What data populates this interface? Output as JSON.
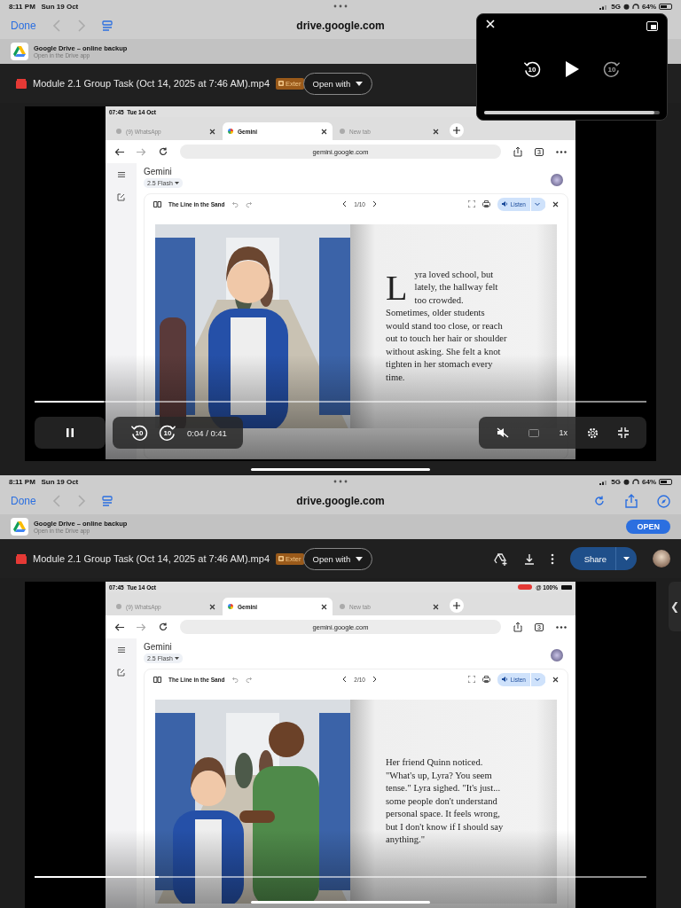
{
  "screens": [
    {
      "status": {
        "time": "8:11 PM",
        "date": "Sun 19 Oct",
        "network": "5G",
        "battery": "64%"
      },
      "toolbar": {
        "done": "Done",
        "url": "drive.google.com"
      },
      "banner": {
        "title": "Google Drive – online backup",
        "subtitle": "Open in the Drive app"
      },
      "file": {
        "name": "Module 2.1 Group Task (Oct 14, 2025 at 7:46 AM).mp4",
        "badge": "Exter",
        "open_with": "Open with"
      },
      "inner": {
        "time": "07:45",
        "date": "Tue 14 Oct",
        "tabs": [
          {
            "label": "(9) WhatsApp",
            "selected": false
          },
          {
            "label": "Gemini",
            "selected": true
          },
          {
            "label": "New tab",
            "selected": false
          }
        ],
        "url": "gemini.google.com",
        "tab_count": "3",
        "app_title": "Gemini",
        "model": "2.5 Flash",
        "book_title": "The Line in the Sand",
        "page": "1/10",
        "listen": "Listen",
        "drop_cap": true,
        "story": "Lyra loved school, but lately, the hallway felt too crowded. Sometimes, older students would stand too close, or reach out to touch her hair or shoulder without asking. She felt a knot tighten in her stomach every time."
      },
      "video": {
        "level": 0.11,
        "controls": {
          "time": "0:04 / 0:41",
          "skip_back": "10",
          "skip_forward": "10",
          "speed": "1x"
        }
      },
      "pip": {
        "skip_back": "10",
        "skip_forward": "10",
        "level": 0.97
      }
    },
    {
      "status": {
        "time": "8:11 PM",
        "date": "Sun 19 Oct",
        "network": "5G",
        "battery": "64%"
      },
      "toolbar": {
        "done": "Done",
        "url": "drive.google.com",
        "actions": true
      },
      "banner": {
        "title": "Google Drive – online backup",
        "subtitle": "Open in the Drive app",
        "button": "OPEN"
      },
      "file": {
        "name": "Module 2.1 Group Task (Oct 14, 2025 at 7:46 AM).mp4",
        "badge": "Exter",
        "open_with": "Open with",
        "share": "Share"
      },
      "inner": {
        "time": "07:45",
        "date": "Tue 14 Oct",
        "battery": "@ 100%",
        "tabs": [
          {
            "label": "(9) WhatsApp",
            "selected": false
          },
          {
            "label": "Gemini",
            "selected": true
          },
          {
            "label": "New tab",
            "selected": false
          }
        ],
        "url": "gemini.google.com",
        "tab_count": "3",
        "app_title": "Gemini",
        "model": "2.5 Flash",
        "book_title": "The Line in the Sand",
        "page": "2/10",
        "listen": "Listen",
        "drop_cap": false,
        "story": "Her friend Quinn noticed. \"What's up, Lyra? You seem tense.\" Lyra sighed. \"It's just... some people don't understand personal space. It feels wrong, but I don't know if I should say anything.\""
      },
      "video": {
        "level": 0.2
      },
      "side_handle": "❮"
    }
  ]
}
